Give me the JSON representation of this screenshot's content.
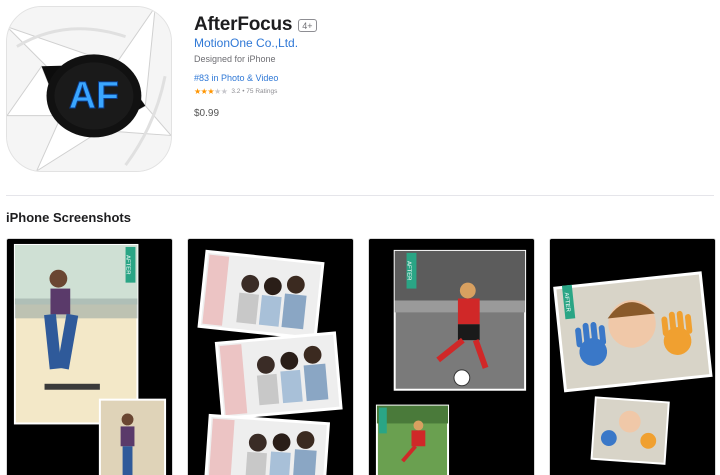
{
  "app": {
    "title": "AfterFocus",
    "age_rating": "4+",
    "developer": "MotionOne Co.,Ltd.",
    "designed_for": "Designed for iPhone",
    "rank": "#83 in Photo & Video",
    "rating_value": 3.2,
    "rating_text": "3.2 • 75 Ratings",
    "price": "$0.99",
    "icon_text": "AF",
    "icon_name": "aperture-icon"
  },
  "screenshots_section": {
    "heading": "iPhone Screenshots",
    "items": [
      {
        "name": "screenshot-skateboarder",
        "label": "AFTER"
      },
      {
        "name": "screenshot-group-photos",
        "label": ""
      },
      {
        "name": "screenshot-soccer-player",
        "label": "AFTER"
      },
      {
        "name": "screenshot-child-painted-hands",
        "label": "AFTER"
      }
    ]
  },
  "colors": {
    "link_blue": "#2f78d6",
    "star_orange": "#ff9500",
    "after_label_green": "#2aa585"
  }
}
